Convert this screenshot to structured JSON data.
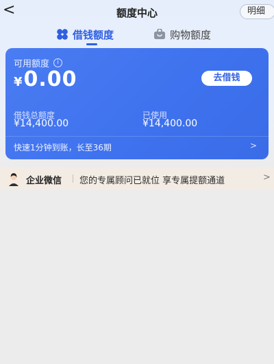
{
  "nav": {
    "back_glyph": "<",
    "title": "额度中心",
    "detail_label": "明细"
  },
  "tabs": [
    {
      "label": "借钱额度",
      "active": true,
      "icon": "clover-icon"
    },
    {
      "label": "购物额度",
      "active": false,
      "icon": "shopping-bag-icon"
    }
  ],
  "card": {
    "available_label": "可用额度",
    "info_glyph": "i",
    "currency": "¥",
    "available_amount": "0.00",
    "borrow_button": "去借钱",
    "total_label": "借钱总额度",
    "total_value": "¥14,400.00",
    "used_label": "已使用",
    "used_value": "¥14,400.00",
    "promo_text": "快速1分钟到账，长至36期",
    "promo_arrow": ">"
  },
  "banner": {
    "name": "企业微信",
    "message": "您的专属顾问已就位 享专属提额通道",
    "arrow": ">"
  },
  "colors": {
    "accent": "#2f5fe0",
    "card": "#3f72ee",
    "banner_bg": "#f3ece4",
    "page_bg": "#ececec"
  }
}
